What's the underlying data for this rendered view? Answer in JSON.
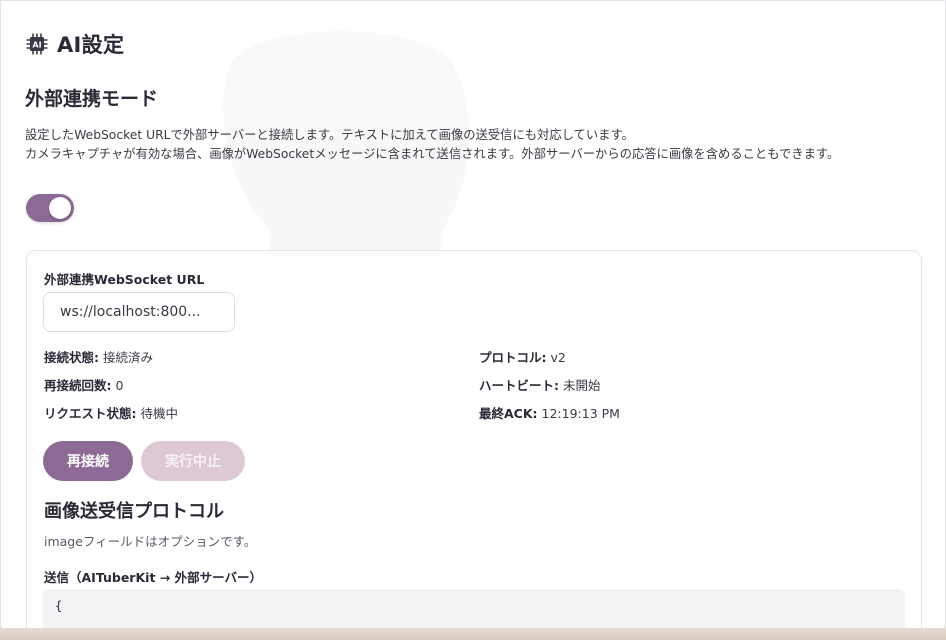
{
  "header": {
    "title": "AI設定",
    "icon": "ai-chip-icon"
  },
  "mode": {
    "title": "外部連携モード",
    "description_lines": [
      "設定したWebSocket URLで外部サーバーと接続します。テキストに加えて画像の送受信にも対応しています。",
      "カメラキャプチャが有効な場合、画像がWebSocketメッセージに含まれて送信されます。外部サーバーからの応答に画像を含めることもできます。"
    ],
    "toggle_on": true
  },
  "connection": {
    "url_label": "外部連携WebSocket URL",
    "url_value": "ws://localhost:800...",
    "status": [
      {
        "key": "接続状態:",
        "value": "接続済み"
      },
      {
        "key": "プロトコル:",
        "value": "v2"
      },
      {
        "key": "再接続回数:",
        "value": "0"
      },
      {
        "key": "ハートビート:",
        "value": "未開始"
      },
      {
        "key": "リクエスト状態:",
        "value": "待機中"
      },
      {
        "key": "最終ACK:",
        "value": "12:19:13 PM"
      }
    ],
    "reconnect_label": "再接続",
    "abort_label": "実行中止"
  },
  "protocol": {
    "title": "画像送受信プロトコル",
    "description": "imageフィールドはオプションです。",
    "send_label": "送信（AITuberKit → 外部サーバー）",
    "code_first_line": "{"
  },
  "colors": {
    "accent": "#8c6a95",
    "disabled": "#ddc9d4"
  }
}
